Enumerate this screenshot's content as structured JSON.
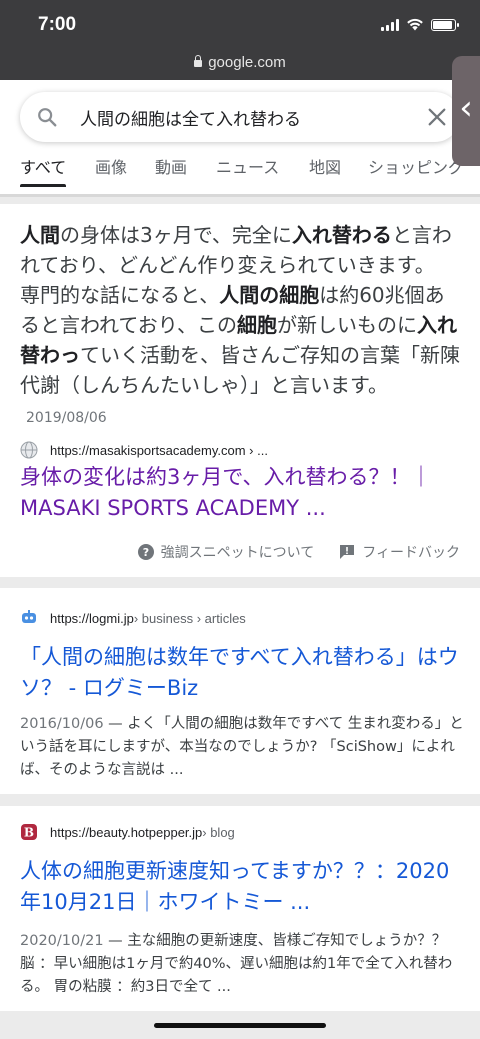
{
  "status_bar": {
    "time": "7:00",
    "battery_level": 0.9
  },
  "browser": {
    "url": "google.com"
  },
  "search": {
    "query": "人間の細胞は全て入れ替わる"
  },
  "tabs": [
    {
      "label": "すべて",
      "active": true
    },
    {
      "label": "画像"
    },
    {
      "label": "動画"
    },
    {
      "label": "ニュース"
    },
    {
      "label": "地図"
    },
    {
      "label": "ショッピング"
    }
  ],
  "featured_snippet": {
    "segments": [
      {
        "t": "人間",
        "b": true
      },
      {
        "t": "の身体は3ヶ月で、完全に"
      },
      {
        "t": "入れ替わる",
        "b": true
      },
      {
        "t": "と言われており、どんどん作り変えられていきます。 専門的な話になると、"
      },
      {
        "t": "人間の細胞",
        "b": true
      },
      {
        "t": "は約60兆個あると言われており、この"
      },
      {
        "t": "細胞",
        "b": true
      },
      {
        "t": "が新しいものに"
      },
      {
        "t": "入れ替わっ",
        "b": true
      },
      {
        "t": "ていく活動を、皆さんご存知の言葉「新陳代謝（しんちんたいしゃ）」と言います。"
      }
    ],
    "date": "2019/08/06",
    "source_url": "https://masakisportsacademy.com › ...",
    "title": "身体の変化は約3ヶ月で、入れ替わる？！｜MASAKI SPORTS ACADEMY ...",
    "about_label": "強調スニペットについて",
    "feedback_label": "フィードバック"
  },
  "results": [
    {
      "domain": "https://logmi.jp",
      "crumbs": " › business › articles",
      "favicon": "robot-icon",
      "title": "「人間の細胞は数年ですべて入れ替わる」はウソ？ - ログミーBiz",
      "date": "2016/10/06",
      "snippet": "よく「人間の細胞は数年ですべて 生まれ変わる」という話を耳にしますが、本当なのでしょうか? 「SciShow」によれば、そのような言説は ..."
    },
    {
      "domain": "https://beauty.hotpepper.jp",
      "crumbs": " › blog",
      "favicon": "hotpepper-b-icon",
      "title": "人体の細胞更新速度知ってますか？？：2020年10月21日｜ホワイトミー ...",
      "date": "2020/10/21",
      "snippet": "主な細胞の更新速度、皆様ご存知でしょうか？？ 脳 ：早い細胞は1ヶ月で約40%、遅い細胞は約1年で全て入れ替わる。 胃の粘膜 ：約3日で全て ..."
    }
  ],
  "colors": {
    "visited_link": "#681da8",
    "link": "#1558d6",
    "status_bar_bg": "#3c3c3e"
  }
}
